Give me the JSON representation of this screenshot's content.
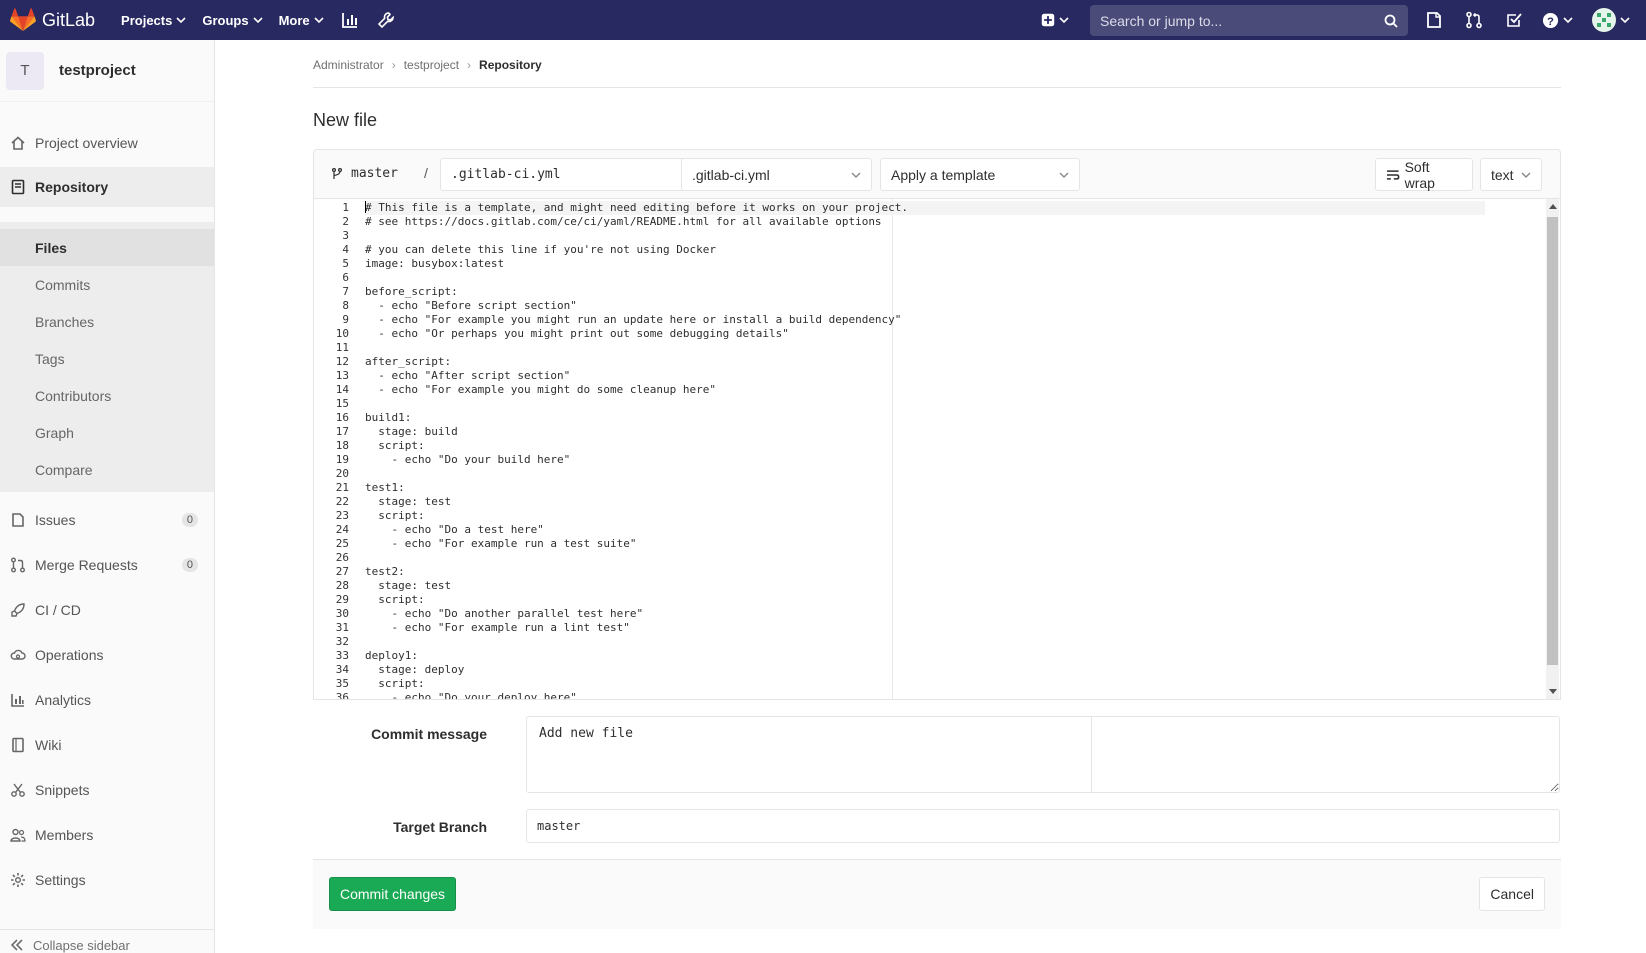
{
  "navbar": {
    "brand": "GitLab",
    "projects": "Projects",
    "groups": "Groups",
    "more": "More",
    "search_placeholder": "Search or jump to..."
  },
  "sidebar": {
    "project_initial": "T",
    "project_name": "testproject",
    "items": {
      "overview": "Project overview",
      "repository": "Repository",
      "files": "Files",
      "commits": "Commits",
      "branches": "Branches",
      "tags": "Tags",
      "contributors": "Contributors",
      "graph": "Graph",
      "compare": "Compare",
      "issues": "Issues",
      "issues_count": "0",
      "merge_requests": "Merge Requests",
      "mr_count": "0",
      "cicd": "CI / CD",
      "operations": "Operations",
      "analytics": "Analytics",
      "wiki": "Wiki",
      "snippets": "Snippets",
      "members": "Members",
      "settings": "Settings",
      "collapse": "Collapse sidebar"
    }
  },
  "breadcrumb": {
    "admin": "Administrator",
    "project": "testproject",
    "current": "Repository"
  },
  "page": {
    "title": "New file"
  },
  "editor": {
    "branch": "master",
    "slash": "/",
    "file_name": ".gitlab-ci.yml",
    "template_type": ".gitlab-ci.yml",
    "apply_template": "Apply a template",
    "soft_wrap": "Soft wrap",
    "mode": "text",
    "lines": [
      "# This file is a template, and might need editing before it works on your project.",
      "# see https://docs.gitlab.com/ce/ci/yaml/README.html for all available options",
      "",
      "# you can delete this line if you're not using Docker",
      "image: busybox:latest",
      "",
      "before_script:",
      "  - echo \"Before script section\"",
      "  - echo \"For example you might run an update here or install a build dependency\"",
      "  - echo \"Or perhaps you might print out some debugging details\"",
      "",
      "after_script:",
      "  - echo \"After script section\"",
      "  - echo \"For example you might do some cleanup here\"",
      "",
      "build1:",
      "  stage: build",
      "  script:",
      "    - echo \"Do your build here\"",
      "",
      "test1:",
      "  stage: test",
      "  script:",
      "    - echo \"Do a test here\"",
      "    - echo \"For example run a test suite\"",
      "",
      "test2:",
      "  stage: test",
      "  script:",
      "    - echo \"Do another parallel test here\"",
      "    - echo \"For example run a lint test\"",
      "",
      "deploy1:",
      "  stage: deploy",
      "  script:",
      "    - echo \"Do your deploy here\""
    ]
  },
  "form": {
    "commit_label": "Commit message",
    "commit_value": "Add new file",
    "target_label": "Target Branch",
    "target_value": "master",
    "commit_button": "Commit changes",
    "cancel_button": "Cancel"
  },
  "colors": {
    "navbar": "#292961",
    "success": "#1aaa55"
  }
}
